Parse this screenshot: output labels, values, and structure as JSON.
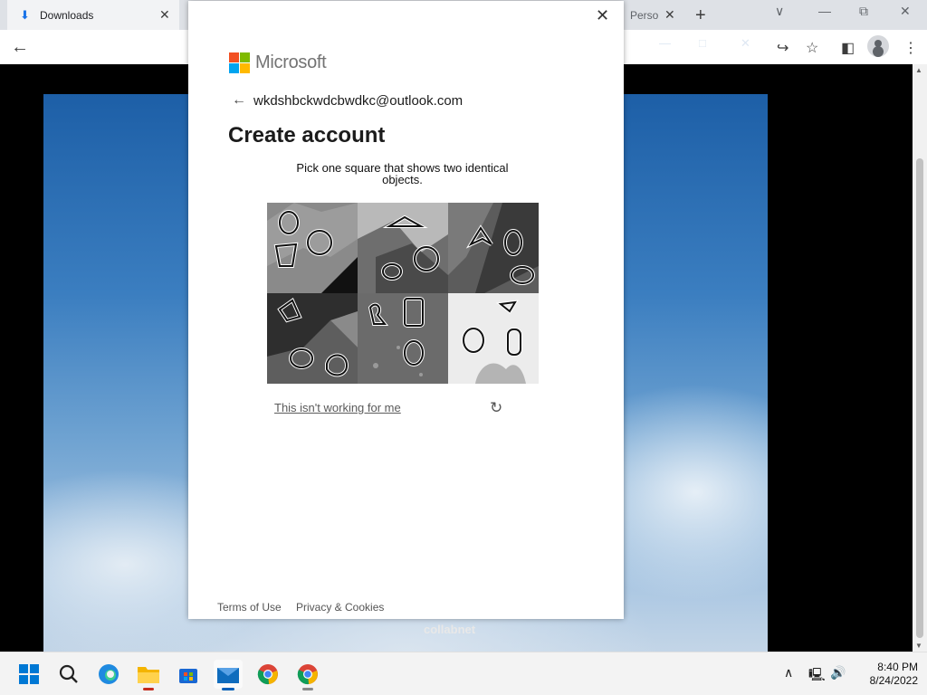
{
  "browser": {
    "tabs": [
      {
        "label": "Downloads"
      },
      {
        "label": "Perso"
      }
    ]
  },
  "dialog": {
    "brand": "Microsoft",
    "email": "wkdshbckwdcbwdkc@outlook.com",
    "title": "Create account",
    "instruction": "Pick one square that shows two identical objects.",
    "puzzle": {
      "tiles": [
        {
          "index": 1,
          "selected": false
        },
        {
          "index": 2,
          "selected": false
        },
        {
          "index": 3,
          "selected": false
        },
        {
          "index": 4,
          "selected": false
        },
        {
          "index": 5,
          "selected": false
        },
        {
          "index": 6,
          "selected": true
        }
      ]
    },
    "help_link": "This isn't working for me",
    "footer": {
      "terms": "Terms of Use",
      "privacy": "Privacy & Cookies"
    }
  },
  "background": {
    "caption": "collabnet"
  },
  "taskbar": {
    "apps": [
      {
        "name": "start"
      },
      {
        "name": "search"
      },
      {
        "name": "edge"
      },
      {
        "name": "file-explorer"
      },
      {
        "name": "store"
      },
      {
        "name": "mail"
      },
      {
        "name": "chrome"
      },
      {
        "name": "chrome"
      }
    ],
    "clock": {
      "time": "8:40 PM",
      "date": "8/24/2022"
    }
  },
  "colors": {
    "ms_red": "#f25022",
    "ms_green": "#7fba00",
    "ms_blue": "#00a4ef",
    "ms_yellow": "#ffb900"
  }
}
